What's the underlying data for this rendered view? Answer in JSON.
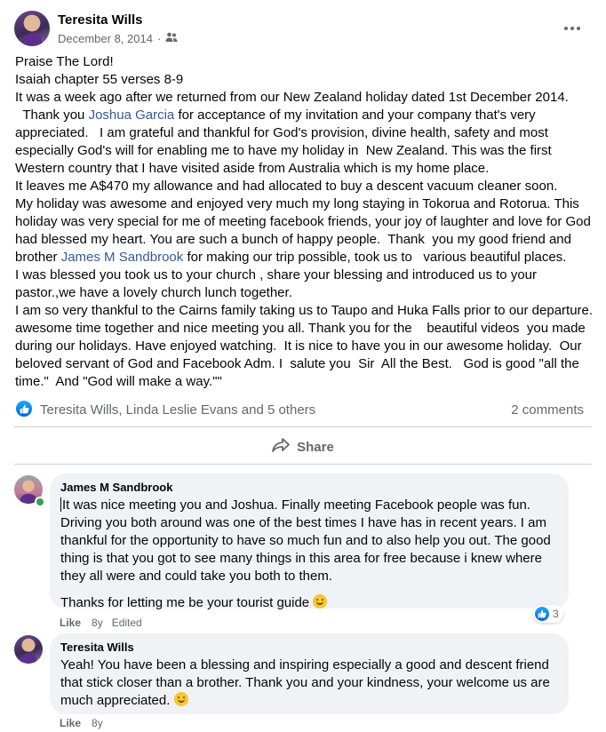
{
  "post": {
    "author": "Teresita Wills",
    "date": "December 8, 2014",
    "separator": "·",
    "audience_icon": "friends-icon",
    "more_icon": "more-horizontal-icon",
    "body": {
      "p1": "Praise The Lord!\nIsaiah chapter 55 verses 8-9\nIt was a week ago after we returned from our New Zealand holiday dated 1st December 2014.\n  Thank you ",
      "mention1": "Joshua Garcia",
      "p2": " for acceptance of my invitation and your company that's very appreciated.   I am grateful and thankful for God's provision, divine health, safety and most especially God's will for enabling me to have my holiday in  New Zealand. This was the first Western country that I have visited aside from Australia which is my home place.\nIt leaves me A$470 my allowance and had allocated to buy a descent vacuum cleaner soon.\nMy holiday was awesome and enjoyed very much my long staying in Tokorua and Rotorua. This holiday was very special for me of meeting facebook friends, your joy of laughter and love for God had blessed my heart. You are such a bunch of happy people.  Thank  you my good friend and brother ",
      "mention2": "James M Sandbrook",
      "p3": " for making our trip possible, took us to   various beautiful places.\nI was blessed you took us to your church , share your blessing and introduced us to your pastor.,we have a lovely church lunch together.\nI am so very thankful to the Cairns family taking us to Taupo and Huka Falls prior to our departure.  awesome time together and nice meeting you all. Thank you for the    beautiful videos  you made during our holidays. Have enjoyed watching.  It is nice to have you in our awesome holiday.  Our beloved servant of God and Facebook Adm. I  salute you  Sir  All the Best.   God is good \"all the time.\"  And \"God will make a way.\"\""
    },
    "reactions": {
      "icon": "like-reaction-icon",
      "names": "Teresita Wills, Linda Leslie Evans and 5 others",
      "comments_count": "2 comments"
    },
    "share_label": "Share",
    "share_icon": "share-icon"
  },
  "comments": [
    {
      "author": "James M Sandbrook",
      "text": "It was nice meeting you and Joshua. Finally meeting Facebook people was fun. Driving you both around was one of the best times I have has in recent years. I am thankful for the opportunity to have so much fun and to also help you out. The good thing is that you got to see many things in this area for free because i knew where they all were and could take you both to them.",
      "text2": "Thanks for letting me be your tourist guide ",
      "like_label": "Like",
      "time": "8y",
      "edited": "Edited",
      "reaction_count": "3",
      "online": true
    },
    {
      "author": "Teresita Wills",
      "text": "Yeah! You have been a blessing and inspiring especially a good and descent friend that stick closer than a brother. Thank you and your kindness, your welcome us are much appreciated. ",
      "like_label": "Like",
      "time": "8y"
    }
  ],
  "colors": {
    "link": "#385898",
    "secondary_text": "#65676b",
    "bubble": "#f0f2f5",
    "like_blue": "#0866ff",
    "online_green": "#31a24c"
  }
}
